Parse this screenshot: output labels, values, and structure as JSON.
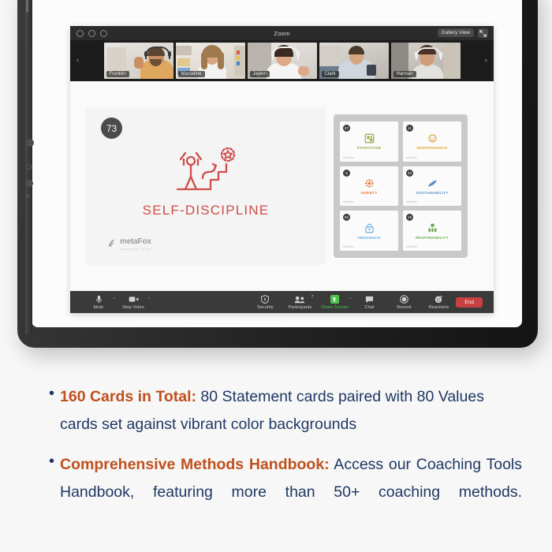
{
  "zoom_window": {
    "title": "Zoom",
    "gallery_view_label": "Gallery View",
    "expand_icon": "expand-icon",
    "participants": [
      {
        "name": "Franklin"
      },
      {
        "name": "Marceline"
      },
      {
        "name": "Jaylen"
      },
      {
        "name": "Clark"
      },
      {
        "name": "Hannah"
      }
    ],
    "nav": {
      "prev": "‹",
      "next": "›"
    }
  },
  "slide": {
    "number": "73",
    "title": "SELF-DISCIPLINE",
    "logo_name": "metaFox",
    "logo_tagline": "coaching tools",
    "accent_color": "#cf4d4a"
  },
  "card_panel": {
    "cards": [
      {
        "label": "PATRIOTISM",
        "number": "27",
        "color": "#9aa845",
        "logo": "metaFox"
      },
      {
        "label": "INDEPENDENCE",
        "number": "11",
        "color": "#e0a93a",
        "logo": "metaFox"
      },
      {
        "label": "VARIETY",
        "number": "8",
        "color": "#e8763a",
        "logo": "metaFox"
      },
      {
        "label": "SUSTAINABILITY",
        "number": "34",
        "color": "#5a8fc4",
        "logo": "metaFox"
      },
      {
        "label": "OBEDIENCE",
        "number": "52",
        "color": "#6fb0dd",
        "logo": "metaFox"
      },
      {
        "label": "RESPONSIBILITY",
        "number": "19",
        "color": "#6cab52",
        "logo": "metaFox"
      }
    ]
  },
  "toolbar": {
    "mute": "Mute",
    "stop_video": "Stop Video",
    "security": "Security",
    "participants": "Participants",
    "participants_count": "7",
    "share_screen": "Share Screen",
    "chat": "Chat",
    "record": "Record",
    "reactions": "Reactions",
    "end": "End",
    "share_color": "#4ec24e",
    "end_color": "#c6413f"
  },
  "bullets": [
    {
      "lead": "160 Cards in Total:",
      "rest": " 80 Statement cards paired with 80 Values cards set against vibrant color backgrounds",
      "justify": false
    },
    {
      "lead": "Comprehensive Methods Handbook:",
      "rest": " Access our Coaching Tools Handbook, featuring more than 50+ coaching methods.",
      "justify": true
    }
  ],
  "colors": {
    "text": "#1f3864",
    "lead": "#c0501d",
    "page_bg": "#f7f7f7"
  }
}
